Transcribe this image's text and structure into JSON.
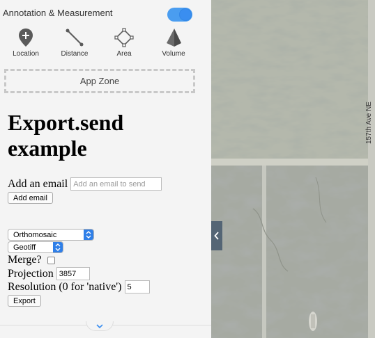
{
  "panel": {
    "title": "Annotation & Measurement",
    "toggle_on": true,
    "tools": [
      {
        "label": "Location",
        "icon": "location-pin-plus-icon"
      },
      {
        "label": "Distance",
        "icon": "distance-line-icon"
      },
      {
        "label": "Area",
        "icon": "area-polygon-icon"
      },
      {
        "label": "Volume",
        "icon": "volume-pyramid-icon"
      }
    ],
    "app_zone_label": "App Zone"
  },
  "content": {
    "heading": "Export.send example",
    "email_label": "Add an email",
    "email_placeholder": "Add an email to send",
    "email_value": "",
    "add_email_button": "Add email",
    "layer_select": "Orthomosaic",
    "format_select": "Geotiff",
    "merge_label": "Merge?",
    "merge_checked": false,
    "projection_label": "Projection",
    "projection_value": "3857",
    "resolution_label": "Resolution (0 for 'native')",
    "resolution_value": "5",
    "export_button": "Export"
  },
  "map": {
    "road_label": "157th Ave NE"
  },
  "colors": {
    "accent": "#3a8ef0",
    "panel_bg": "#f4f4f4",
    "map_toggle": "#546575"
  }
}
